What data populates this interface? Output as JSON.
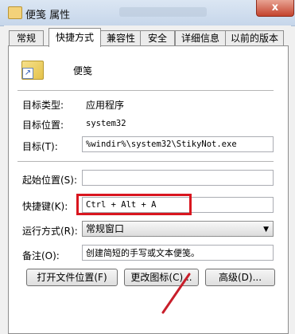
{
  "window": {
    "title": "便笺 属性",
    "close_label": "x"
  },
  "tabs": [
    {
      "label": "常规"
    },
    {
      "label": "快捷方式"
    },
    {
      "label": "兼容性"
    },
    {
      "label": "安全"
    },
    {
      "label": "详细信息"
    },
    {
      "label": "以前的版本"
    }
  ],
  "app": {
    "name": "便笺",
    "icon": "sticky-notes-shortcut-icon"
  },
  "fields": {
    "target_type_label": "目标类型:",
    "target_type_value": "应用程序",
    "target_location_label": "目标位置:",
    "target_location_value": "system32",
    "target_label": "目标(T):",
    "target_value": "%windir%\\system32\\StikyNot.exe",
    "start_in_label": "起始位置(S):",
    "start_in_value": "",
    "shortcut_key_label": "快捷键(K):",
    "shortcut_key_value": "Ctrl + Alt + A",
    "run_label": "运行方式(R):",
    "run_value": "常规窗口",
    "comment_label": "备注(O):",
    "comment_value": "创建简短的手写或文本便笺。"
  },
  "buttons": {
    "open_location": "打开文件位置(F)",
    "change_icon": "更改图标(C)...",
    "advanced": "高级(D)..."
  },
  "colors": {
    "highlight": "#d9161f",
    "annotation_arrow": "#c81e2a"
  }
}
